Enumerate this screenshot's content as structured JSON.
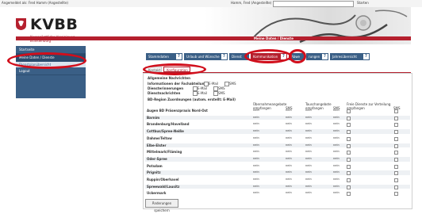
{
  "topbar": {
    "left": "Angemeldet als: Fred Hamm (Angestellte)",
    "who": "Hamm, Fred (Angestellte)",
    "tail": "Starten"
  },
  "brand": {
    "name": "KVBB",
    "sub1": "Kassenärztliche Vereinigung",
    "sub2": "Brandenburg"
  },
  "colors": {
    "accent": "#b5202e",
    "nav": "#3a5f86",
    "highlight": "#d10e1b"
  },
  "breadcrumb": "Meine Daten / Dienste",
  "sidebar": {
    "items": [
      {
        "label": "Startseite"
      },
      {
        "label": "Meine Daten / Dienste"
      },
      {
        "label": "Dienstplanübersicht"
      },
      {
        "label": "Logout"
      }
    ]
  },
  "tabs": [
    {
      "label": "Stammdaten"
    },
    {
      "label": "Urlaub und Wünsche"
    },
    {
      "label": "Dienst"
    },
    {
      "label": "Kommunikation"
    },
    {
      "label": "Abwe"
    },
    {
      "label": "rungen"
    },
    {
      "label": "Jahresübersicht"
    }
  ],
  "subtabs": [
    {
      "label": "Kontakt"
    },
    {
      "label": "Konfiguration"
    }
  ],
  "section": {
    "heading": "Allgemeine Nachrichten",
    "lines": [
      {
        "label": "Informationen der Fachabteilung",
        "opt1": "E-Mail",
        "opt2": "SMS"
      },
      {
        "label": "Diensterinnerungen",
        "opt1": "E-Mail",
        "opt2": "SMS"
      },
      {
        "label": "Dienstnachrichten",
        "opt1": "E-Mail",
        "opt2": "SMS"
      }
    ],
    "regional": "BD-Region Zuordnungen (autom. erstellt: E-Mail)"
  },
  "table": {
    "groups": [
      "Übernahmeangebote",
      "Tauschangebote",
      "Freie Dienste zur Verteilung"
    ],
    "subheaders": [
      "empfangen",
      "SMS",
      "empfangen",
      "SMS",
      "empfangen",
      "SMS"
    ],
    "rows": [
      {
        "name": "Augen BD Präsenzpraxis Nord-Ost",
        "v": [
          "nein",
          "nein",
          "nein",
          "nein"
        ]
      },
      {
        "name": "Barnim",
        "v": [
          "nein",
          "nein",
          "nein",
          "nein"
        ]
      },
      {
        "name": "Brandenburg/Havelland",
        "v": [
          "nein",
          "nein",
          "nein",
          "nein"
        ]
      },
      {
        "name": "Cottbus/Spree-Neiße",
        "v": [
          "nein",
          "nein",
          "nein",
          "nein"
        ]
      },
      {
        "name": "Dahme/Teltow",
        "v": [
          "nein",
          "nein",
          "nein",
          "nein"
        ]
      },
      {
        "name": "Elbe-Elster",
        "v": [
          "nein",
          "nein",
          "nein",
          "nein"
        ]
      },
      {
        "name": "Mittelmark/Fläming",
        "v": [
          "nein",
          "nein",
          "nein",
          "nein"
        ]
      },
      {
        "name": "Oder-Spree",
        "v": [
          "nein",
          "nein",
          "nein",
          "nein"
        ]
      },
      {
        "name": "Potsdam",
        "v": [
          "nein",
          "nein",
          "nein",
          "nein"
        ]
      },
      {
        "name": "Prignitz",
        "v": [
          "nein",
          "nein",
          "nein",
          "nein"
        ]
      },
      {
        "name": "Ruppin/Oberhavel",
        "v": [
          "nein",
          "nein",
          "nein",
          "nein"
        ]
      },
      {
        "name": "Spreewald/Lausitz",
        "v": [
          "nein",
          "nein",
          "nein",
          "nein"
        ]
      },
      {
        "name": "Uckermark",
        "v": [
          "nein",
          "nein",
          "nein",
          "nein"
        ]
      }
    ]
  },
  "save_label": "Änderungen speichern"
}
